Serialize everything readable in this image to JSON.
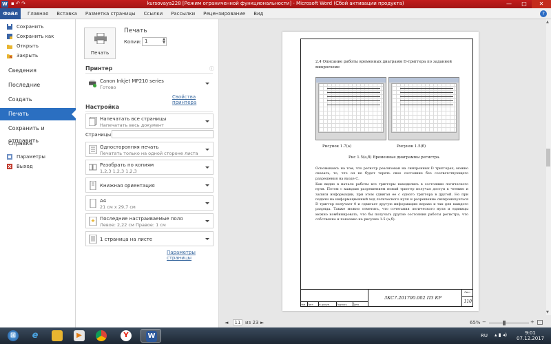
{
  "window": {
    "title": "kursovaya228 [Режим ограниченной функциональности] - Microsoft Word (Сбой активации продукта)",
    "app_icon_letter": "W",
    "controls": [
      "—",
      "□",
      "✕"
    ]
  },
  "ribbon": {
    "file_tab": "Файл",
    "tabs": [
      "Главная",
      "Вставка",
      "Разметка страницы",
      "Ссылки",
      "Рассылки",
      "Рецензирование",
      "Вид"
    ],
    "help": "?"
  },
  "nav": {
    "save": "Сохранить",
    "save_as": "Сохранить как",
    "open": "Открыть",
    "close": "Закрыть",
    "info": "Сведения",
    "recent": "Последние",
    "new": "Создать",
    "print": "Печать",
    "save_send": "Сохранить и отправить",
    "help": "Справка",
    "options": "Параметры",
    "exit": "Выход"
  },
  "print_panel": {
    "title": "Печать",
    "print_button": "Печать",
    "copies_label": "Копии:",
    "copies_value": "1",
    "printer_header": "Принтер",
    "printer_name": "Canon Inkjet MP210 series",
    "printer_status": "Готово",
    "printer_props_link": "Свойства принтера",
    "settings_header": "Настройка",
    "print_all": "Напечатать все страницы",
    "print_all_desc": "Напечатать весь документ",
    "pages_label": "Страницы:",
    "pages_value": "",
    "one_sided": "Односторонняя печать",
    "one_sided_desc": "Печатать только на одной стороне листа",
    "collated": "Разобрать по копиям",
    "collated_desc": "1,2,3    1,2,3    1,2,3",
    "orientation": "Книжная ориентация",
    "paper_size": "А4",
    "paper_size_desc": "21 см x 29,7 см",
    "margins": "Последние настраиваемые поля",
    "margins_desc": "Левое:  2,22 см    Правое:  1 см",
    "per_sheet": "1 страница на листе",
    "page_setup_link": "Параметры страницы"
  },
  "document": {
    "heading": "2.4 Описание работы временных диаграмм D-триггера по заданной микросхеме",
    "figure_a_caption": "Рисунок 1.7(а)",
    "figure_b_caption": "Рисунок 1.5(б)",
    "figure_main_caption": "Рис 1.5(а,б) Временные диаграммы регистра.",
    "paragraph_1": "Основываясь на том, что регистр реализован на синхронных D триггерах, можно сказать, то, что он не будет терять свое состояние без соответствующего разрешения на входе С.",
    "paragraph_2": "Как видно в начале работы все триггеры находились в состоянии логического нуля. Потом с каждым разрешением новый триггер получал доступ к чтению и записи информации, при этом сдвигая ее с одного триггера в другой. Но при подачи на информационный ход логического нуля и разрешение синхронизуеться D триггер получает 0 и сдвигает другую информацию вправо и так для каждого разряда. Также можно отметить, что сочетания логического нуля и единицы можно комбинировать, что бы получать другие состояния работы регистра, что собственно и показано на рисунке 1.5 (а,б).",
    "stamp_code": "3КС7.201700.002  ПЗ КР",
    "stamp_sheet_label": "Лист",
    "stamp_page": "110",
    "stamp_columns": [
      "Изм",
      "Лист",
      "№ докум.",
      "Подпись",
      "Дата"
    ]
  },
  "pager": {
    "prev": "◄",
    "current": "11",
    "of": "из 23",
    "next": "►"
  },
  "zoom": {
    "percent": "65%",
    "minus": "−",
    "plus": "+",
    "level": 0.65
  },
  "taskbar": {
    "lang": "RU",
    "time": "9:01",
    "date": "07.12.2017"
  },
  "colors": {
    "title_bar": "#b51a1a",
    "file_tab": "#2b579a",
    "nav_active": "#2b6fc1",
    "link": "#3b6aa0"
  }
}
